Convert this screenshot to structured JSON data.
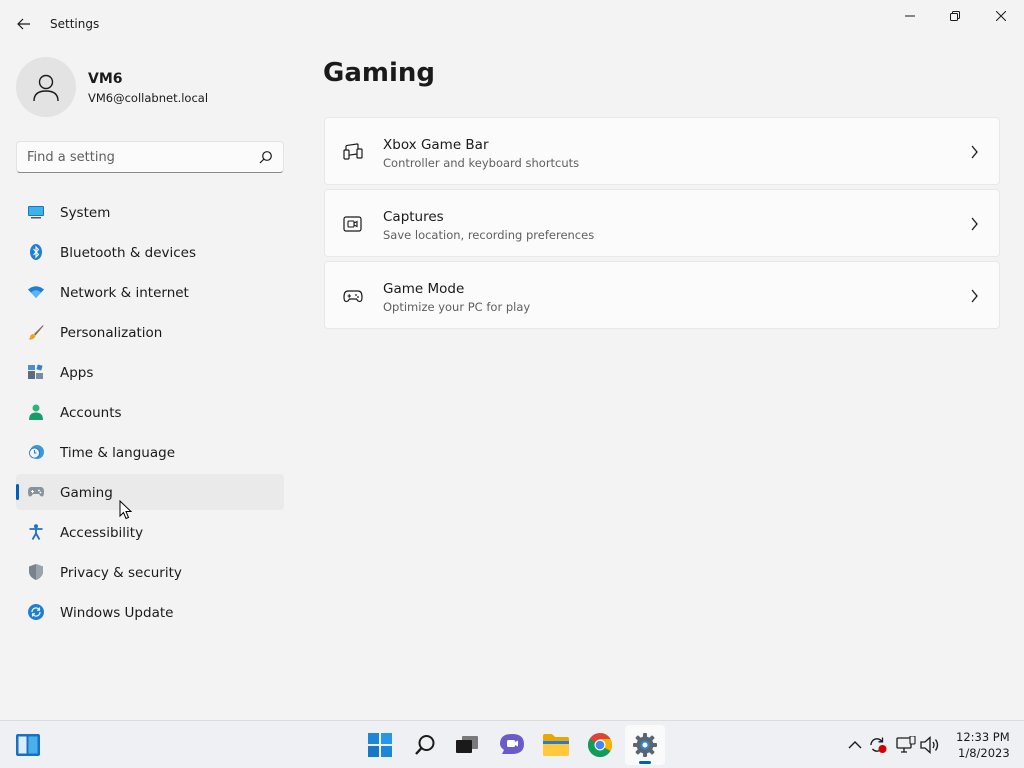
{
  "window": {
    "title": "Settings"
  },
  "user": {
    "name": "VM6",
    "email": "VM6@collabnet.local"
  },
  "search": {
    "placeholder": "Find a setting",
    "value": ""
  },
  "nav": {
    "items": [
      {
        "label": "System",
        "icon": "system-icon",
        "active": false
      },
      {
        "label": "Bluetooth & devices",
        "icon": "bluetooth-icon",
        "active": false
      },
      {
        "label": "Network & internet",
        "icon": "wifi-icon",
        "active": false
      },
      {
        "label": "Personalization",
        "icon": "brush-icon",
        "active": false
      },
      {
        "label": "Apps",
        "icon": "apps-icon",
        "active": false
      },
      {
        "label": "Accounts",
        "icon": "person-icon",
        "active": false
      },
      {
        "label": "Time & language",
        "icon": "clock-globe-icon",
        "active": false
      },
      {
        "label": "Gaming",
        "icon": "gamepad-icon",
        "active": true
      },
      {
        "label": "Accessibility",
        "icon": "accessibility-icon",
        "active": false
      },
      {
        "label": "Privacy & security",
        "icon": "shield-icon",
        "active": false
      },
      {
        "label": "Windows Update",
        "icon": "update-icon",
        "active": false
      }
    ]
  },
  "main": {
    "title": "Gaming",
    "cards": [
      {
        "title": "Xbox Game Bar",
        "description": "Controller and keyboard shortcuts",
        "icon": "game-bar-icon"
      },
      {
        "title": "Captures",
        "description": "Save location, recording preferences",
        "icon": "capture-icon"
      },
      {
        "title": "Game Mode",
        "description": "Optimize your PC for play",
        "icon": "game-mode-icon"
      }
    ]
  },
  "taskbar": {
    "apps": [
      "start-icon",
      "search-icon",
      "task-view-icon",
      "chat-icon",
      "file-explorer-icon",
      "chrome-icon",
      "settings-gear-icon"
    ],
    "clock": {
      "time": "12:33 PM",
      "date": "1/8/2023"
    }
  },
  "colors": {
    "accent": "#005fb8",
    "background": "#f3f3f3",
    "card": "#fbfbfb"
  }
}
